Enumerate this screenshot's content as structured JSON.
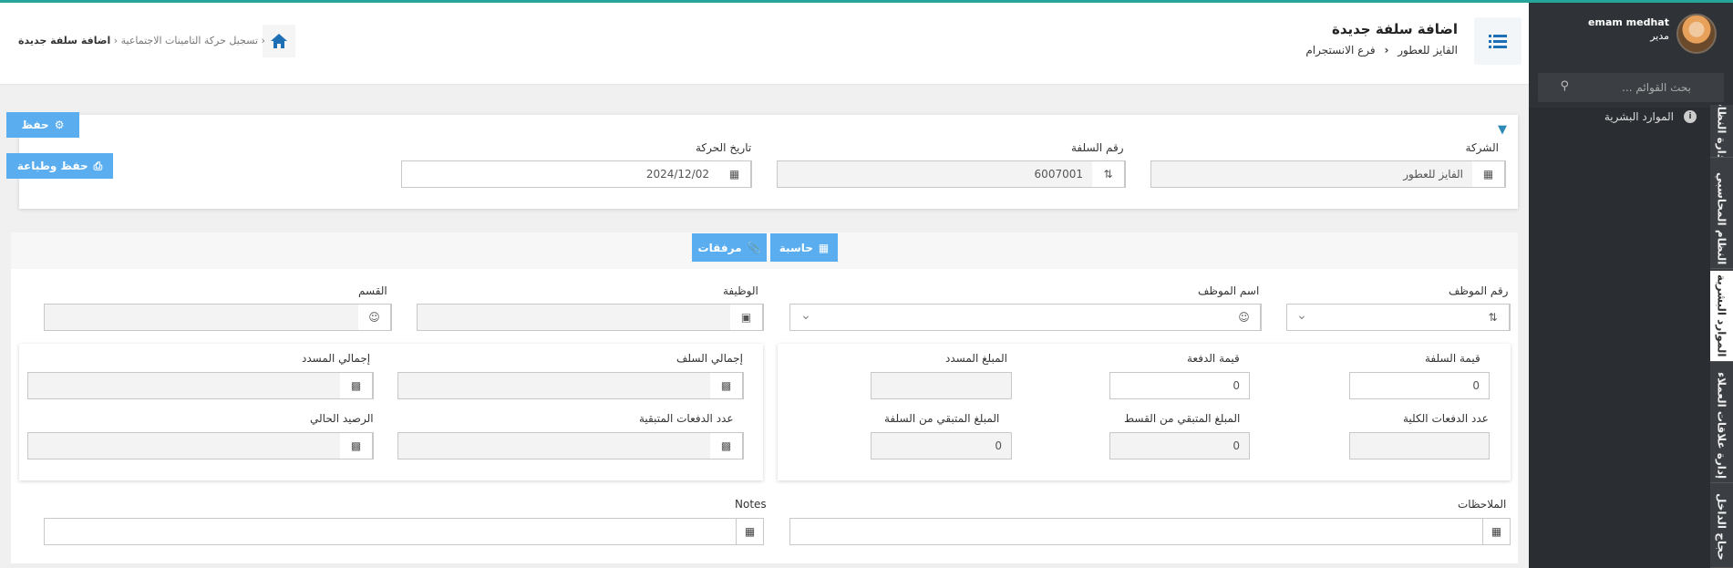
{
  "sidebar": {
    "user_name": "emam medhat",
    "user_role": "مدير",
    "search_placeholder": "بحث القوائم ...",
    "submenu_item": "الموارد البشرية",
    "vtabs": [
      "ادارة النظام",
      "النظام المحاسبي",
      "الموارد البشرية",
      "إدارة علاقات العملاء",
      "حجاج الداخل"
    ]
  },
  "header": {
    "title": "اضافة سلفة جديدة",
    "company": "الفايز للعطور",
    "branch": "فرع الانستجرام",
    "breadcrumb_parent": "تسجيل حركة التامينات الاجتماعية",
    "breadcrumb_current": "اضافة سلفة جديدة"
  },
  "actions": {
    "save": "حفظ",
    "save_print": "حفظ وطباعة"
  },
  "form": {
    "company_label": "الشركة",
    "company_value": "الفايز للعطور",
    "advance_no_label": "رقم السلفة",
    "advance_no_value": "6007001",
    "date_label": "تاريخ الحركة",
    "date_value": "2024/12/02"
  },
  "tabs": {
    "calculator": "حاسبة",
    "attachments": "مرفقات"
  },
  "employee": {
    "emp_no_label": "رقم الموظف",
    "emp_name_label": "اسم الموظف",
    "job_label": "الوظيفة",
    "dept_label": "القسم"
  },
  "advance": {
    "amount_label": "قيمة السلفة",
    "amount_value": "0",
    "payment_label": "قيمة الدفعة",
    "payment_value": "0",
    "paid_label": "المبلغ المسدد",
    "total_payments_label": "عدد الدفعات الكلية",
    "remaining_installment_label": "المبلغ المتبقي من القسط",
    "remaining_installment_value": "0",
    "remaining_advance_label": "المبلغ المتبقي من السلفة",
    "remaining_advance_value": "0"
  },
  "totals": {
    "total_advances_label": "إجمالي السلف",
    "total_paid_label": "إجمالي المسدد",
    "remaining_payments_label": "عدد الدفعات المتبقية",
    "current_balance_label": "الرصيد الحالي"
  },
  "notes": {
    "ar_label": "الملاحظات",
    "en_label": "Notes"
  }
}
